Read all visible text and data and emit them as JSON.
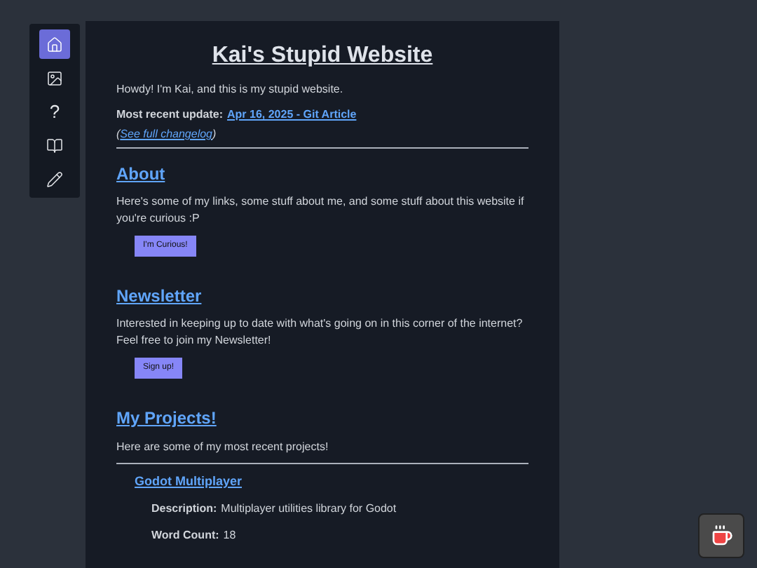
{
  "nav": [
    {
      "kind": "home",
      "selected": true
    },
    {
      "kind": "frame",
      "selected": false
    },
    {
      "kind": "glyph",
      "text": "?",
      "selected": false
    },
    {
      "kind": "book",
      "selected": false
    },
    {
      "kind": "pencil",
      "selected": false
    }
  ],
  "title": "Kai's Stupid Website",
  "intro": "Howdy! I'm Kai, and this is my stupid website.",
  "update": {
    "label": "Most recent update:",
    "link": "Apr 16, 2025 - Git Article"
  },
  "changelog": {
    "open": "(",
    "link": "See full changelog",
    "close": ")"
  },
  "sections": [
    {
      "heading": "About",
      "text": "Here's some of my links, some stuff about me, and some stuff about this website if you're curious :P",
      "button": "I'm Curious!"
    },
    {
      "heading": "Newsletter",
      "text": "Interested in keeping up to date with what's going on in this corner of the internet? Feel free to join my Newsletter!",
      "button": "Sign up!"
    }
  ],
  "projects": {
    "heading": "My Projects!",
    "text": "Here are some of my most recent projects!",
    "items": [
      {
        "title": "Godot Multiplayer",
        "fields": [
          {
            "label": "Description:",
            "value": "Multiplayer utilities library for Godot"
          },
          {
            "label": "Word Count:",
            "value": "18"
          }
        ]
      }
    ]
  }
}
